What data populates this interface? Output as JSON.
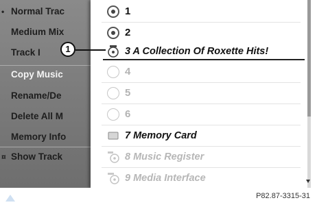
{
  "menu": {
    "items": [
      {
        "bullet": "•",
        "label": "Normal Trac"
      },
      {
        "bullet": "",
        "label": "Medium Mix"
      },
      {
        "bullet": "",
        "label": "Track I"
      },
      {
        "bullet": "",
        "label": "Copy Music"
      },
      {
        "bullet": "",
        "label": "Rename/De"
      },
      {
        "bullet": "",
        "label": "Delete All M"
      },
      {
        "bullet": "",
        "label": "Memory Info"
      },
      {
        "bullet": "¤",
        "label": "Show Track"
      }
    ]
  },
  "list": {
    "rows": [
      {
        "label": "1",
        "icon": "disc-radio-selected-icon",
        "state": "enabled"
      },
      {
        "label": "2",
        "icon": "disc-radio-selected-icon",
        "state": "enabled"
      },
      {
        "label": "3 A Collection Of Roxette Hits!",
        "icon": "cd-icon",
        "state": "selected"
      },
      {
        "label": "4",
        "icon": "radio-empty-icon",
        "state": "disabled"
      },
      {
        "label": "5",
        "icon": "radio-empty-icon",
        "state": "disabled"
      },
      {
        "label": "6",
        "icon": "radio-empty-icon",
        "state": "disabled"
      },
      {
        "label": "7 Memory Card",
        "icon": "memory-card-icon",
        "state": "enabled"
      },
      {
        "label": "8 Music Register",
        "icon": "music-register-icon",
        "state": "disabled"
      },
      {
        "label": "9 Media Interface",
        "icon": "media-interface-icon",
        "state": "disabled"
      }
    ]
  },
  "callout": {
    "number": "1"
  },
  "caption": "P82.87-3315-31",
  "colors": {
    "screen_bg": "#6e6e6e",
    "panel_bg": "#ffffff",
    "text_dark": "#111111",
    "text_disabled": "#b3b3b3"
  }
}
